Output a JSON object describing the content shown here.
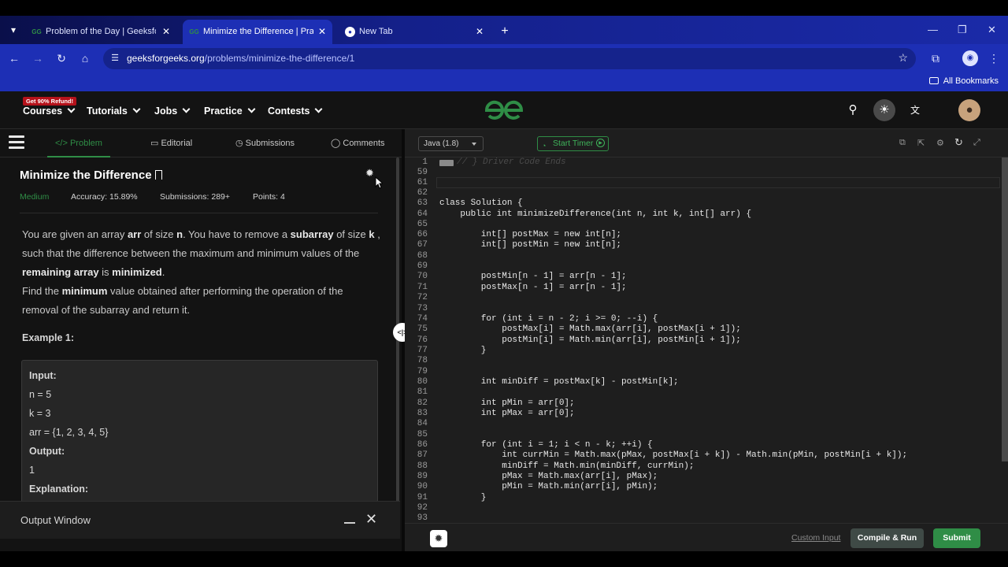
{
  "browser": {
    "tabs": [
      {
        "title": "Problem of the Day | GeeksforG",
        "favicon": "GG",
        "active": false
      },
      {
        "title": "Minimize the Difference | Practi",
        "favicon": "GG",
        "active": true
      },
      {
        "title": "New Tab",
        "favicon": "chrome-icon",
        "active": false
      }
    ],
    "url_domain": "geeksforgeeks.org",
    "url_path": "/problems/minimize-the-difference/1",
    "all_bookmarks": "All Bookmarks"
  },
  "header": {
    "promo": "Get 90% Refund!",
    "menu": [
      "Courses",
      "Tutorials",
      "Jobs",
      "Practice",
      "Contests"
    ],
    "colors": {
      "brand": "#2f8d46"
    }
  },
  "left": {
    "tabs": [
      "Problem",
      "Editorial",
      "Submissions",
      "Comments"
    ],
    "title": "Minimize the Difference",
    "difficulty": "Medium",
    "accuracy": "Accuracy: 15.89%",
    "submissions": "Submissions: 289+",
    "points": "Points: 4",
    "example_label": "Example 1:",
    "example": {
      "input_label": "Input:",
      "n": "n = 5",
      "k": "k = 3",
      "arr": "arr = {1, 2, 3, 4, 5}",
      "output_label": "Output:",
      "output": "1",
      "explanation_label": "Explanation:"
    },
    "output_window": "Output Window"
  },
  "editor": {
    "language": "Java (1.8)",
    "timer": "Start Timer",
    "custom_input": "Custom Input",
    "compile_run": "Compile & Run",
    "submit": "Submit",
    "lines": [
      {
        "n": "1",
        "code": "// } Driver Code Ends"
      },
      {
        "n": "59",
        "code": ""
      },
      {
        "n": "61",
        "code": ""
      },
      {
        "n": "62",
        "code": ""
      },
      {
        "n": "63",
        "code": "class Solution {"
      },
      {
        "n": "64",
        "code": "    public int minimizeDifference(int n, int k, int[] arr) {"
      },
      {
        "n": "65",
        "code": ""
      },
      {
        "n": "66",
        "code": "        int[] postMax = new int[n];"
      },
      {
        "n": "67",
        "code": "        int[] postMin = new int[n];"
      },
      {
        "n": "68",
        "code": ""
      },
      {
        "n": "69",
        "code": ""
      },
      {
        "n": "70",
        "code": "        postMin[n - 1] = arr[n - 1];"
      },
      {
        "n": "71",
        "code": "        postMax[n - 1] = arr[n - 1];"
      },
      {
        "n": "72",
        "code": ""
      },
      {
        "n": "73",
        "code": ""
      },
      {
        "n": "74",
        "code": "        for (int i = n - 2; i >= 0; --i) {"
      },
      {
        "n": "75",
        "code": "            postMax[i] = Math.max(arr[i], postMax[i + 1]);"
      },
      {
        "n": "76",
        "code": "            postMin[i] = Math.min(arr[i], postMin[i + 1]);"
      },
      {
        "n": "77",
        "code": "        }"
      },
      {
        "n": "78",
        "code": ""
      },
      {
        "n": "79",
        "code": ""
      },
      {
        "n": "80",
        "code": "        int minDiff = postMax[k] - postMin[k];"
      },
      {
        "n": "81",
        "code": ""
      },
      {
        "n": "82",
        "code": "        int pMin = arr[0];"
      },
      {
        "n": "83",
        "code": "        int pMax = arr[0];"
      },
      {
        "n": "84",
        "code": ""
      },
      {
        "n": "85",
        "code": ""
      },
      {
        "n": "86",
        "code": "        for (int i = 1; i < n - k; ++i) {"
      },
      {
        "n": "87",
        "code": "            int currMin = Math.max(pMax, postMax[i + k]) - Math.min(pMin, postMin[i + k]);"
      },
      {
        "n": "88",
        "code": "            minDiff = Math.min(minDiff, currMin);"
      },
      {
        "n": "89",
        "code": "            pMax = Math.max(arr[i], pMax);"
      },
      {
        "n": "90",
        "code": "            pMin = Math.min(arr[i], pMin);"
      },
      {
        "n": "91",
        "code": "        }"
      },
      {
        "n": "92",
        "code": ""
      },
      {
        "n": "93",
        "code": ""
      }
    ]
  }
}
